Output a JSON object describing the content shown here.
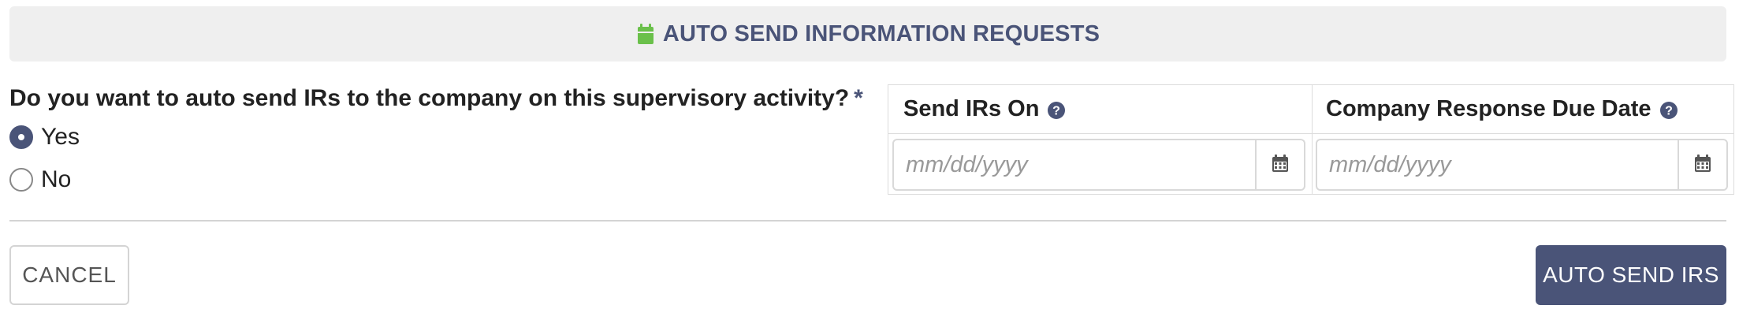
{
  "header": {
    "title": "AUTO SEND INFORMATION REQUESTS",
    "icon": "calendar-icon",
    "icon_color": "#6ac04a"
  },
  "question": {
    "text": "Do you want to auto send IRs to the company on this supervisory activity?",
    "required_marker": "*"
  },
  "radio_options": [
    {
      "label": "Yes",
      "checked": true
    },
    {
      "label": "No",
      "checked": false
    }
  ],
  "dates": {
    "send_irs_on": {
      "label": "Send IRs On",
      "placeholder": "mm/dd/yyyy",
      "value": "",
      "help_icon": "question-circle-icon"
    },
    "response_due": {
      "label": "Company Response Due Date",
      "placeholder": "mm/dd/yyyy",
      "value": "",
      "help_icon": "question-circle-icon"
    }
  },
  "buttons": {
    "cancel": "CANCEL",
    "submit": "AUTO SEND IRS"
  },
  "colors": {
    "primary": "#4a5478",
    "header_bg": "#efefef",
    "accent_green": "#6ac04a"
  }
}
